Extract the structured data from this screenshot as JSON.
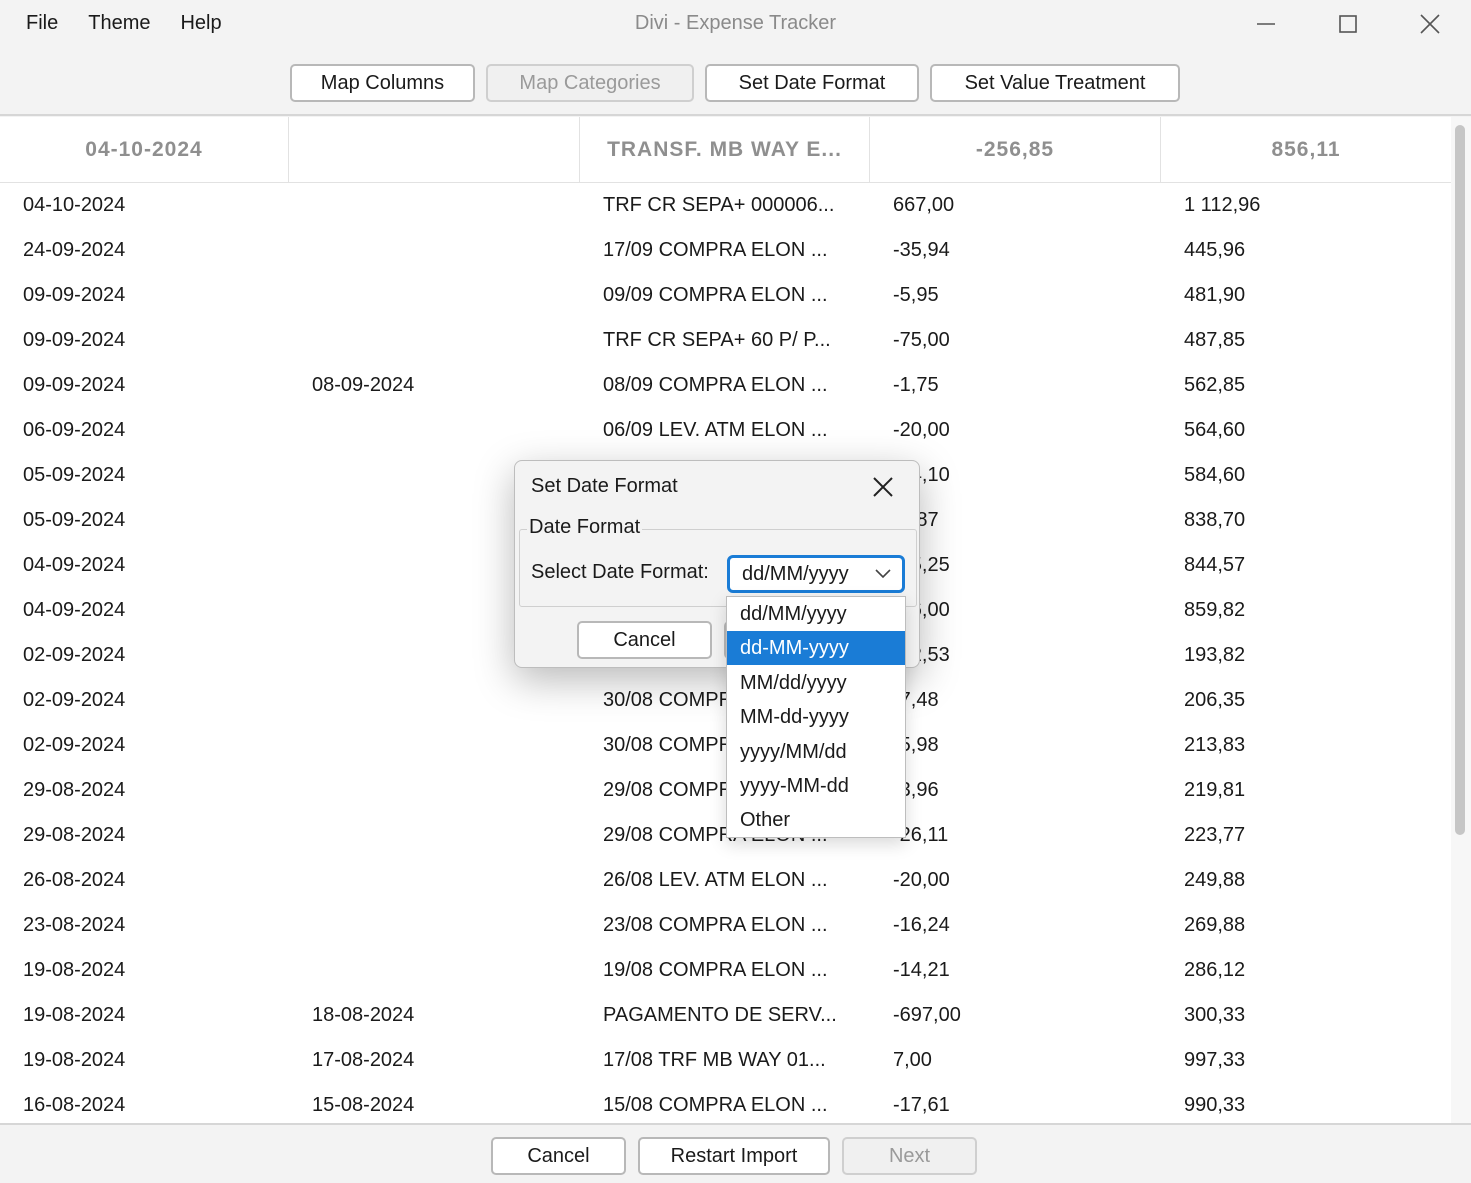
{
  "window": {
    "title": "Divi - Expense Tracker",
    "menu": [
      "File",
      "Theme",
      "Help"
    ]
  },
  "toolbar": {
    "map_columns": "Map Columns",
    "map_categories": "Map Categories",
    "set_date_format": "Set Date Format",
    "set_value_treatment": "Set Value Treatment"
  },
  "table": {
    "headers": [
      "04-10-2024",
      "",
      "TRANSF. MB WAY E...",
      "-256,85",
      "856,11"
    ],
    "rows": [
      [
        "04-10-2024",
        "",
        "TRF CR SEPA+ 000006...",
        "667,00",
        "1 112,96"
      ],
      [
        "24-09-2024",
        "",
        "17/09 COMPRA ELON ...",
        "-35,94",
        "445,96"
      ],
      [
        "09-09-2024",
        "",
        "09/09 COMPRA ELON ...",
        "-5,95",
        "481,90"
      ],
      [
        "09-09-2024",
        "",
        "TRF CR SEPA+ 60 P/ P...",
        "-75,00",
        "487,85"
      ],
      [
        "09-09-2024",
        "08-09-2024",
        "08/09 COMPRA ELON ...",
        "-1,75",
        "562,85"
      ],
      [
        "06-09-2024",
        "",
        "06/09 LEV. ATM ELON ...",
        "-20,00",
        "564,60"
      ],
      [
        "05-09-2024",
        "",
        "",
        "-54,10",
        "584,60"
      ],
      [
        "05-09-2024",
        "",
        "",
        "-6,87",
        "838,70"
      ],
      [
        "04-09-2024",
        "",
        "",
        "-15,25",
        "844,57"
      ],
      [
        "04-09-2024",
        "",
        "",
        "-16,00",
        "859,82"
      ],
      [
        "02-09-2024",
        "",
        "",
        "-12,53",
        "193,82"
      ],
      [
        "02-09-2024",
        "",
        "30/08 COMPRA ELON ...",
        "-7,48",
        "206,35"
      ],
      [
        "02-09-2024",
        "",
        "30/08 COMPRA ELON ...",
        "-5,98",
        "213,83"
      ],
      [
        "29-08-2024",
        "",
        "29/08 COMPRA ELON ...",
        "-3,96",
        "219,81"
      ],
      [
        "29-08-2024",
        "",
        "29/08 COMPRA ELON ...",
        "-26,11",
        "223,77"
      ],
      [
        "26-08-2024",
        "",
        "26/08 LEV. ATM ELON ...",
        "-20,00",
        "249,88"
      ],
      [
        "23-08-2024",
        "",
        "23/08 COMPRA ELON ...",
        "-16,24",
        "269,88"
      ],
      [
        "19-08-2024",
        "",
        "19/08 COMPRA ELON ...",
        "-14,21",
        "286,12"
      ],
      [
        "19-08-2024",
        "18-08-2024",
        "PAGAMENTO DE SERV...",
        "-697,00",
        "300,33"
      ],
      [
        "19-08-2024",
        "17-08-2024",
        "17/08 TRF MB WAY 01...",
        "7,00",
        "997,33"
      ],
      [
        "16-08-2024",
        "15-08-2024",
        "15/08 COMPRA ELON ...",
        "-17,61",
        "990,33"
      ]
    ]
  },
  "bottom": {
    "cancel": "Cancel",
    "restart": "Restart Import",
    "next": "Next"
  },
  "dialog": {
    "title": "Set Date Format",
    "group_label": "Date Format",
    "select_label": "Select Date Format:",
    "selected_value": "dd/MM/yyyy",
    "cancel": "Cancel",
    "ok": "OK",
    "options": [
      "dd/MM/yyyy",
      "dd-MM-yyyy",
      "MM/dd/yyyy",
      "MM-dd-yyyy",
      "yyyy/MM/dd",
      "yyyy-MM-dd",
      "Other"
    ],
    "highlighted_option": "dd-MM-yyyy"
  },
  "colors": {
    "accent": "#1a7cd6",
    "header_text": "#8f8f8f",
    "disabled_text": "#9a9a9a"
  }
}
